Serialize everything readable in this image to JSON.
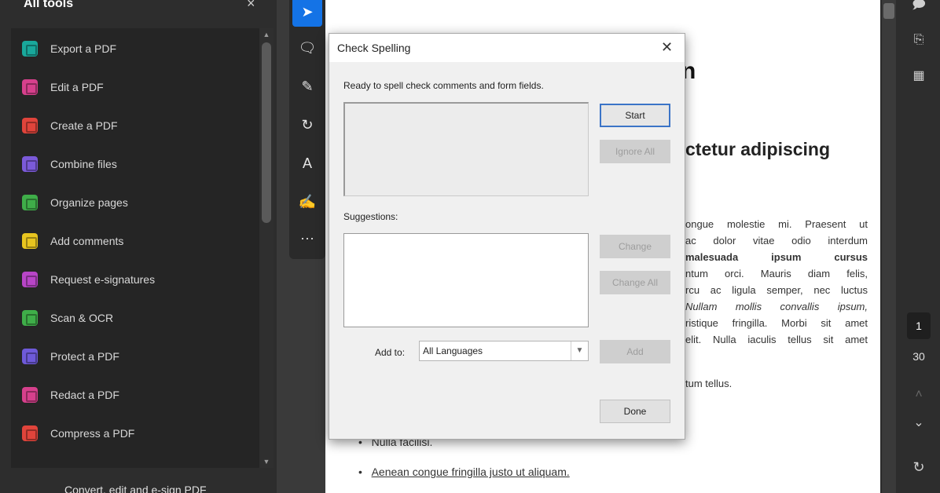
{
  "left_panel": {
    "title": "All tools",
    "close": "×",
    "tools": [
      {
        "label": "Export a PDF",
        "icon": "export-pdf-icon",
        "color": "#19a89b"
      },
      {
        "label": "Edit a PDF",
        "icon": "edit-pdf-icon",
        "color": "#d6408c"
      },
      {
        "label": "Create a PDF",
        "icon": "create-pdf-icon",
        "color": "#e0443b"
      },
      {
        "label": "Combine files",
        "icon": "combine-files-icon",
        "color": "#7b5ad9"
      },
      {
        "label": "Organize pages",
        "icon": "organize-pages-icon",
        "color": "#3fae49"
      },
      {
        "label": "Add comments",
        "icon": "add-comments-icon",
        "color": "#e8c51f"
      },
      {
        "label": "Request e-signatures",
        "icon": "request-esignatures-icon",
        "color": "#b845c7"
      },
      {
        "label": "Scan & OCR",
        "icon": "scan-ocr-icon",
        "color": "#3fae49"
      },
      {
        "label": "Protect a PDF",
        "icon": "protect-pdf-icon",
        "color": "#6e5ad9"
      },
      {
        "label": "Redact a PDF",
        "icon": "redact-pdf-icon",
        "color": "#d6408c"
      },
      {
        "label": "Compress a PDF",
        "icon": "compress-pdf-icon",
        "color": "#e0443b"
      }
    ],
    "footer": "Convert, edit and e-sign PDF"
  },
  "dialog": {
    "title": "Check Spelling",
    "close": "✕",
    "status": "Ready to spell check comments and form fields.",
    "suggestions_label": "Suggestions:",
    "add_to_label": "Add to:",
    "language": "All Languages",
    "buttons": {
      "start": "Start",
      "ignore_all": "Ignore All",
      "change": "Change",
      "change_all": "Change All",
      "add": "Add",
      "done": "Done"
    }
  },
  "document": {
    "heading1": "n",
    "heading2": "ctetur adipiscing",
    "lines": [
      "ongue molestie mi. Praesent ut",
      "ac dolor vitae odio interdum",
      "malesuada ipsum cursus",
      "ntum orci. Mauris diam felis,",
      "rcu ac ligula semper, nec luctus",
      "Nullam mollis convallis ipsum,",
      "ristique fringilla. Morbi sit amet",
      "elit. Nulla iaculis tellus sit amet"
    ],
    "line_tum": "tum tellus.",
    "bullets": [
      "Nulla facilisi.",
      "Aenean congue fringilla justo ut aliquam."
    ]
  },
  "right_rail": {
    "current_page": "1",
    "total_pages": "30"
  }
}
